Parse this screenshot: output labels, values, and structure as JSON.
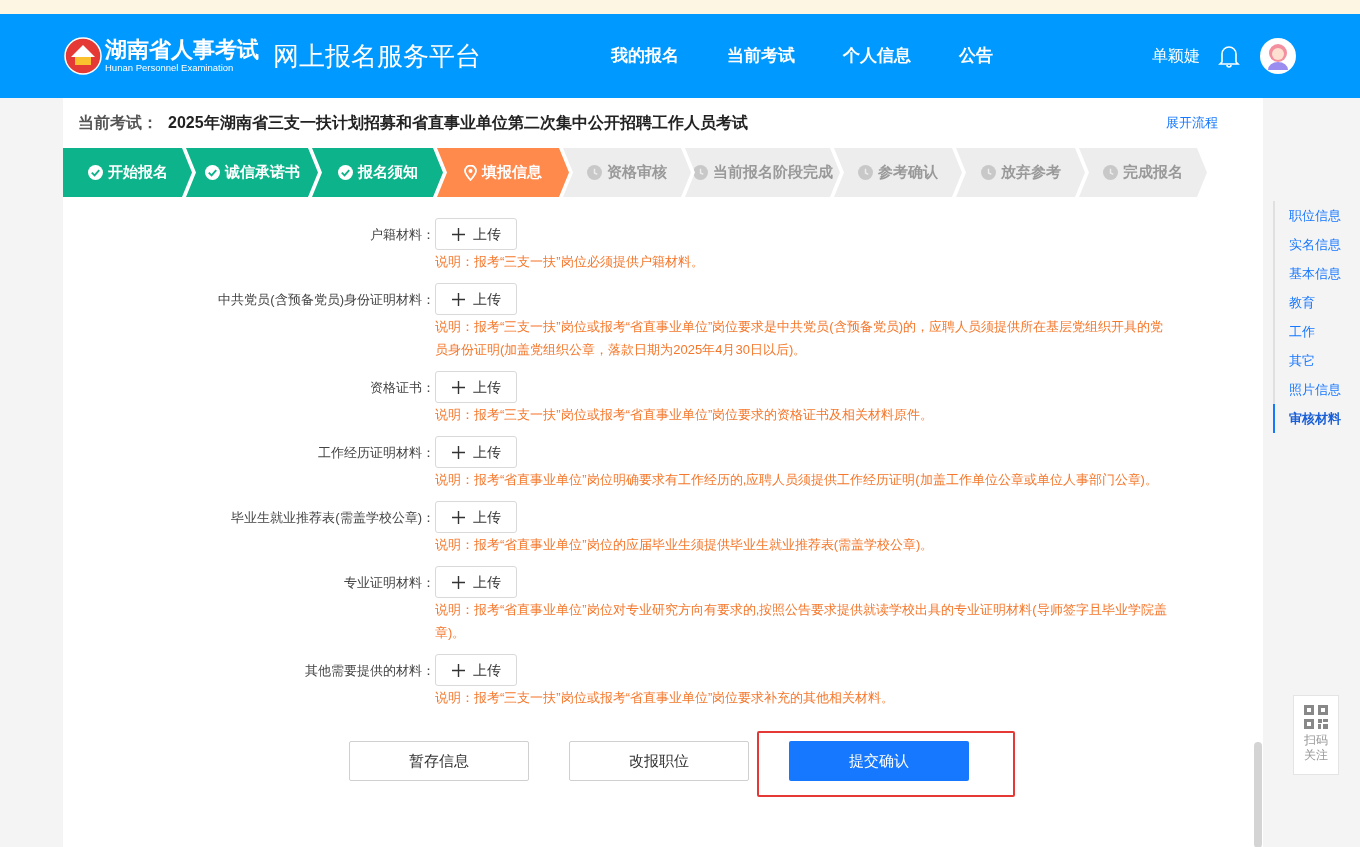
{
  "header": {
    "logo_title": "湖南省人事考试",
    "logo_subtitle": "Hunan Personnel Examination",
    "platform": "网上报名服务平台",
    "nav": [
      {
        "label": "我的报名",
        "selected": false
      },
      {
        "label": "当前考试",
        "selected": false
      },
      {
        "label": "个人信息",
        "selected": false
      },
      {
        "label": "公告",
        "selected": false
      }
    ],
    "user": "单颖婕"
  },
  "exam": {
    "label": "当前考试：",
    "title": "2025年湖南省三支一扶计划招募和省直事业单位第二次集中公开招聘工作人员考试",
    "expand_link": "展开流程"
  },
  "steps": [
    {
      "label": "开始报名",
      "kind": "done"
    },
    {
      "label": "诚信承诺书",
      "kind": "done"
    },
    {
      "label": "报名须知",
      "kind": "done"
    },
    {
      "label": "填报信息",
      "kind": "current"
    },
    {
      "label": "资格审核",
      "kind": "pending"
    },
    {
      "label": "当前报名阶段完成",
      "kind": "pending"
    },
    {
      "label": "参考确认",
      "kind": "pending"
    },
    {
      "label": "放弃参考",
      "kind": "pending"
    },
    {
      "label": "完成报名",
      "kind": "pending"
    }
  ],
  "materials": [
    {
      "label": "户籍材料：",
      "button": "上传",
      "note": "说明：报考“三支一扶”岗位必须提供户籍材料。"
    },
    {
      "label": "中共党员(含预备党员)身份证明材料：",
      "button": "上传",
      "note": "说明：报考“三支一扶”岗位或报考“省直事业单位”岗位要求是中共党员(含预备党员)的，应聘人员须提供所在基层党组织开具的党员身份证明(加盖党组织公章，落款日期为2025年4月30日以后)。"
    },
    {
      "label": "资格证书：",
      "button": "上传",
      "note": "说明：报考“三支一扶”岗位或报考“省直事业单位”岗位要求的资格证书及相关材料原件。"
    },
    {
      "label": "工作经历证明材料：",
      "button": "上传",
      "note": "说明：报考“省直事业单位”岗位明确要求有工作经历的,应聘人员须提供工作经历证明(加盖工作单位公章或单位人事部门公章)。"
    },
    {
      "label": "毕业生就业推荐表(需盖学校公章)：",
      "button": "上传",
      "note": "说明：报考“省直事业单位”岗位的应届毕业生须提供毕业生就业推荐表(需盖学校公章)。"
    },
    {
      "label": "专业证明材料：",
      "button": "上传",
      "note": "说明：报考“省直事业单位”岗位对专业研究方向有要求的,按照公告要求提供就读学校出具的专业证明材料(导师签字且毕业学院盖章)。"
    },
    {
      "label": "其他需要提供的材料：",
      "button": "上传",
      "note": "说明：报考“三支一扶”岗位或报考“省直事业单位”岗位要求补充的其他相关材料。"
    }
  ],
  "actions": [
    {
      "label": "暂存信息",
      "kind": "plain",
      "highlighted": false
    },
    {
      "label": "改报职位",
      "kind": "plain",
      "highlighted": false
    },
    {
      "label": "提交确认",
      "kind": "primary",
      "highlighted": true
    }
  ],
  "side_nav": [
    {
      "label": "职位信息",
      "selected": false
    },
    {
      "label": "实名信息",
      "selected": false
    },
    {
      "label": "基本信息",
      "selected": false
    },
    {
      "label": "教育",
      "selected": false
    },
    {
      "label": "工作",
      "selected": false
    },
    {
      "label": "其它",
      "selected": false
    },
    {
      "label": "照片信息",
      "selected": false
    },
    {
      "label": "审核材料",
      "selected": true
    }
  ],
  "qr": {
    "label_line1": "扫码",
    "label_line2": "关注"
  }
}
